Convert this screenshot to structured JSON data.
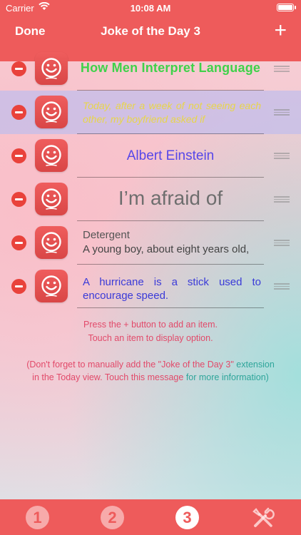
{
  "status": {
    "carrier": "Carrier",
    "time": "10:08 AM"
  },
  "nav": {
    "done": "Done",
    "title": "Joke of the Day 3",
    "add": "+"
  },
  "items": [
    {
      "text": "How Men Interpret Language"
    },
    {
      "text": "Today, after a week of not seeing each other, my boyfriend asked if"
    },
    {
      "text": "Albert Einstein"
    },
    {
      "text": "I’m afraid of"
    },
    {
      "title": "Detergent",
      "text": "A young boy, about eight years old,"
    },
    {
      "text": "A hurricane is a stick used to encourage speed."
    }
  ],
  "hints": {
    "line1": "Press the + button to add an item.",
    "line2": "Touch an item to display option."
  },
  "message": {
    "line1_a": "(Don't forget to manually add the \"Joke of the Day 3\"",
    "line1_b": " extension",
    "line2_a": "in the Today view. Touch this message",
    "line2_b": " for more information)"
  },
  "tabs": [
    {
      "label": "1"
    },
    {
      "label": "2"
    },
    {
      "label": "3"
    },
    {
      "label": "tools"
    }
  ],
  "colors": {
    "accent": "#ee5b5b",
    "delete": "#e9423b",
    "teal": "#2ea59a"
  }
}
